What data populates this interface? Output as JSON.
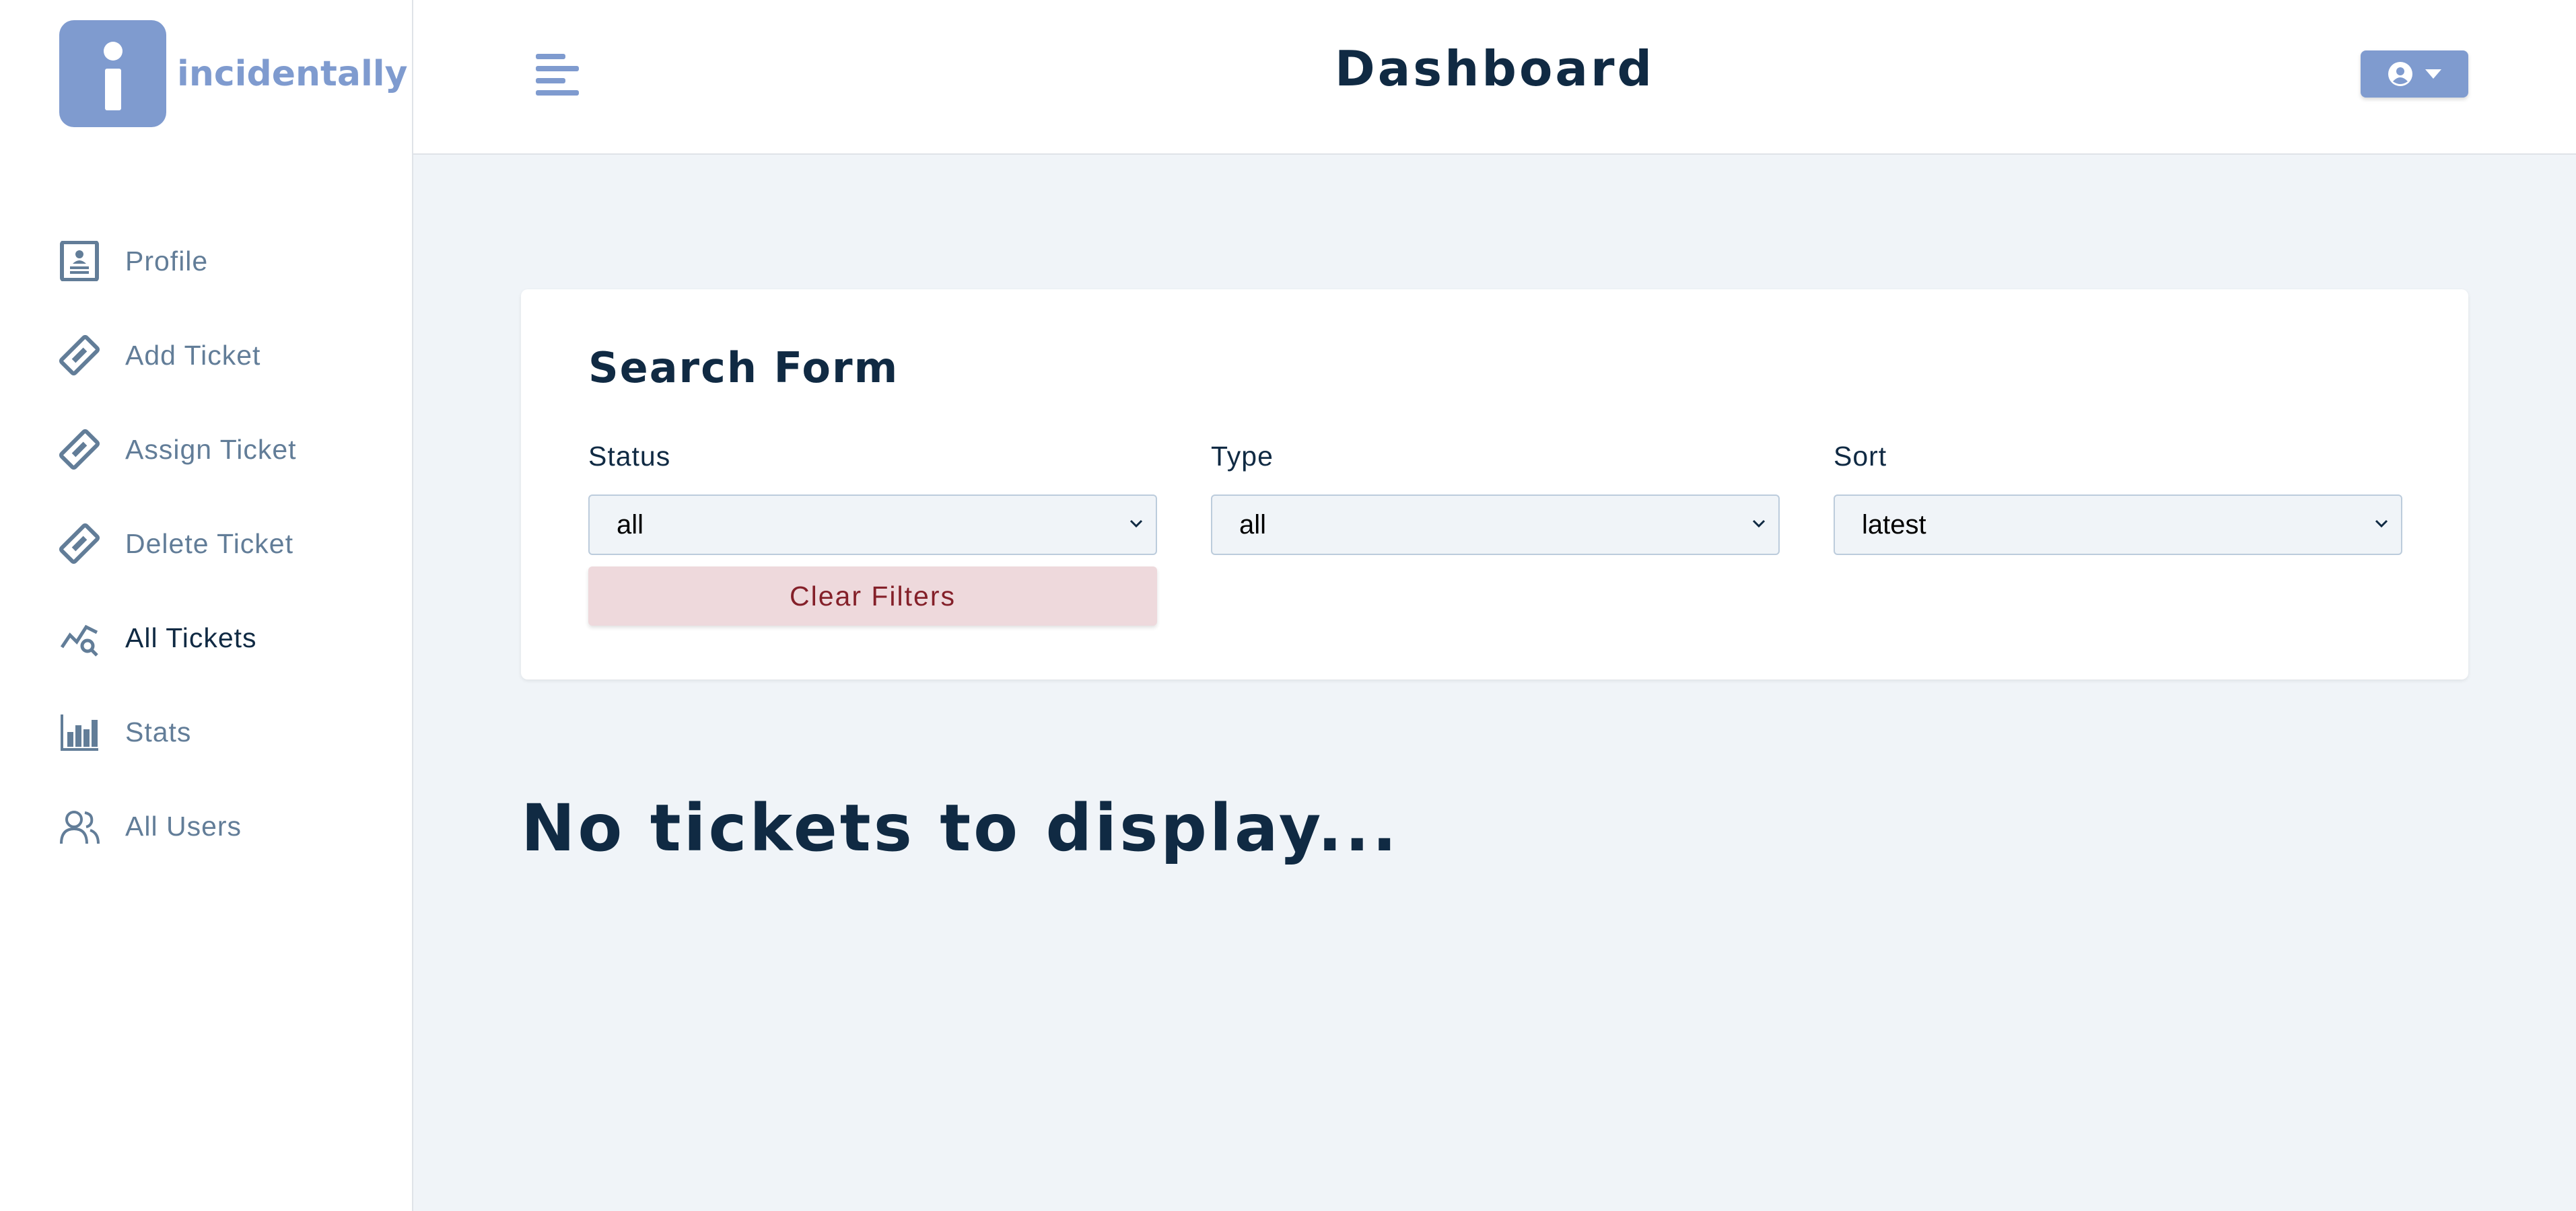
{
  "app": {
    "name": "incidentally",
    "colors": {
      "brand": "#7f9bcf",
      "background": "#f0f4f8",
      "danger_bg": "#eed9dc",
      "danger_text": "#842029"
    }
  },
  "header": {
    "title": "Dashboard",
    "toggle_icon": "menu-align-left-icon",
    "user_icon": "user-circle-icon"
  },
  "sidebar": {
    "items": [
      {
        "label": "Profile",
        "icon": "profile-card-icon",
        "active": false
      },
      {
        "label": "Add Ticket",
        "icon": "ticket-icon",
        "active": false
      },
      {
        "label": "Assign Ticket",
        "icon": "ticket-icon",
        "active": false
      },
      {
        "label": "Delete Ticket",
        "icon": "ticket-icon",
        "active": false
      },
      {
        "label": "All Tickets",
        "icon": "chart-search-icon",
        "active": true
      },
      {
        "label": "Stats",
        "icon": "bar-chart-icon",
        "active": false
      },
      {
        "label": "All Users",
        "icon": "users-icon",
        "active": false
      }
    ]
  },
  "search_form": {
    "title": "Search Form",
    "status": {
      "label": "Status",
      "value": "all"
    },
    "type": {
      "label": "Type",
      "value": "all"
    },
    "sort": {
      "label": "Sort",
      "value": "latest"
    },
    "clear_label": "Clear Filters"
  },
  "main": {
    "empty_message": "No tickets to display..."
  }
}
